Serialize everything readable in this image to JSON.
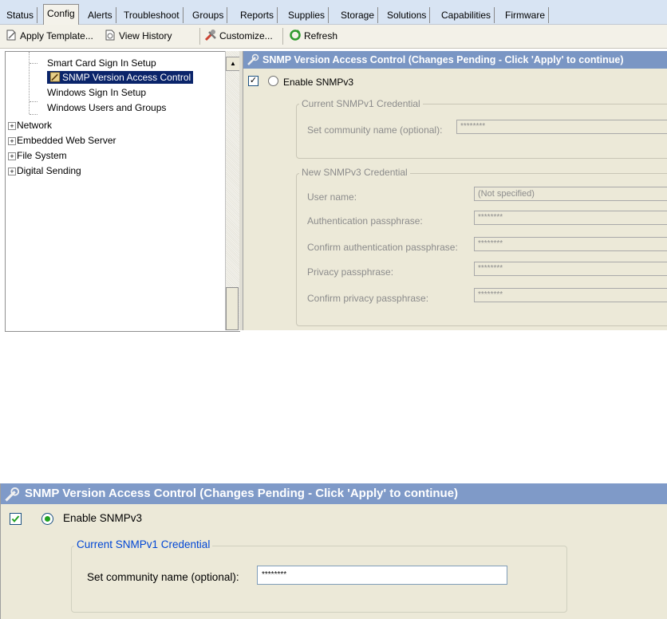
{
  "tabs": [
    {
      "label": "Status"
    },
    {
      "label": "Config",
      "active": true
    },
    {
      "label": "Alerts"
    },
    {
      "label": "Troubleshoot"
    },
    {
      "label": "Groups"
    },
    {
      "label": "Reports"
    },
    {
      "label": "Supplies"
    },
    {
      "label": "Storage"
    },
    {
      "label": "Solutions"
    },
    {
      "label": "Capabilities"
    },
    {
      "label": "Firmware"
    }
  ],
  "toolbar": {
    "apply_template": "Apply Template...",
    "view_history": "View History",
    "customize": "Customize...",
    "refresh": "Refresh"
  },
  "tree": {
    "items": [
      {
        "label": "Smart Card Sign In Setup"
      },
      {
        "label": "SNMP Version Access Control",
        "selected": true
      },
      {
        "label": "Windows Sign In Setup"
      },
      {
        "label": "Windows Users and Groups"
      }
    ],
    "groups": [
      {
        "label": "Network",
        "expander": "+"
      },
      {
        "label": "Embedded Web Server",
        "expander": "+"
      },
      {
        "label": "File System",
        "expander": "+"
      },
      {
        "label": "Digital Sending",
        "expander": "+"
      }
    ]
  },
  "panel": {
    "title": "SNMP Version Access Control (Changes Pending - Click 'Apply' to continue)",
    "checkbox_mark": "✓",
    "enable_label": "Enable SNMPv3",
    "current_legend": "Current SNMPv1 Credential",
    "community_label": "Set community name (optional):",
    "community_value": "********",
    "new_legend": "New SNMPv3 Credential",
    "fields": [
      {
        "label": "User name:",
        "value": "(Not specified)"
      },
      {
        "label": "Authentication passphrase:",
        "value": "********"
      },
      {
        "label": "Confirm authentication passphrase:",
        "value": "********"
      },
      {
        "label": "Privacy passphrase:",
        "value": "********"
      },
      {
        "label": "Confirm privacy passphrase:",
        "value": "********"
      }
    ]
  },
  "zoom_panel": {
    "title": "SNMP Version Access Control (Changes Pending - Click 'Apply' to continue)",
    "enable_label": "Enable SNMPv3",
    "current_legend": "Current SNMPv1 Credential",
    "community_label": "Set community name (optional):",
    "community_value": "********"
  },
  "colors": {
    "title_bar": "#7a96c4",
    "selection": "#0a246a",
    "panel_bg": "#ece9d8",
    "legend_blue": "#0046d5"
  }
}
